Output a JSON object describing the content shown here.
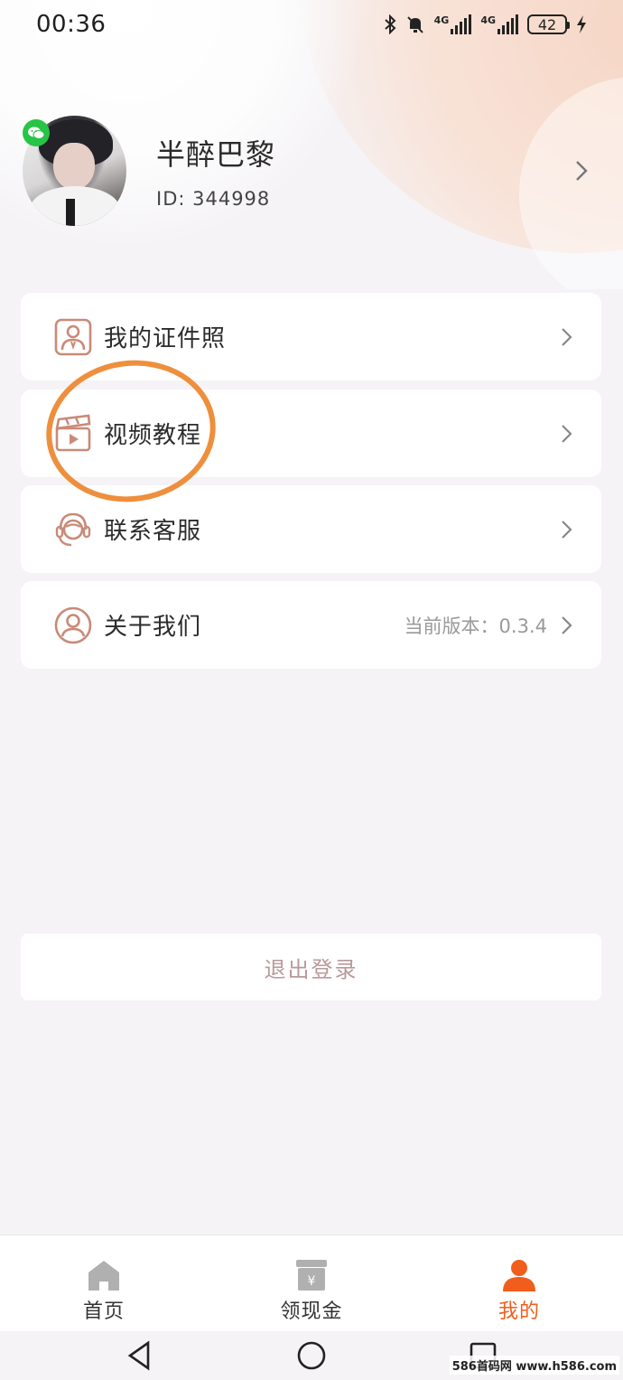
{
  "status_bar": {
    "time": "00:36",
    "network_1": "4G",
    "network_2": "4G",
    "battery": "42"
  },
  "profile": {
    "nickname": "半醉巴黎",
    "id_text": "ID:  344998",
    "badge_icon": "wechat-icon"
  },
  "menu": {
    "items": [
      {
        "label": "我的证件照",
        "icon": "id-photo-icon",
        "value": ""
      },
      {
        "label": "视频教程",
        "icon": "video-clapper-icon",
        "value": ""
      },
      {
        "label": "联系客服",
        "icon": "customer-service-icon",
        "value": ""
      },
      {
        "label": "关于我们",
        "icon": "user-circle-icon",
        "value": "当前版本：0.3.4"
      }
    ]
  },
  "logout": {
    "label": "退出登录"
  },
  "tab_bar": {
    "tabs": [
      {
        "label": "首页",
        "icon": "home-icon",
        "active": false
      },
      {
        "label": "领现金",
        "icon": "cash-icon",
        "active": false
      },
      {
        "label": "我的",
        "icon": "profile-icon",
        "active": true
      }
    ]
  },
  "watermark": "586首码网 www.h586.com",
  "colors": {
    "accent": "#f15d1c",
    "icon": "#c98a78",
    "annotation": "#ee8f3d",
    "inactive_tab_icon": "#b0b0b0"
  }
}
